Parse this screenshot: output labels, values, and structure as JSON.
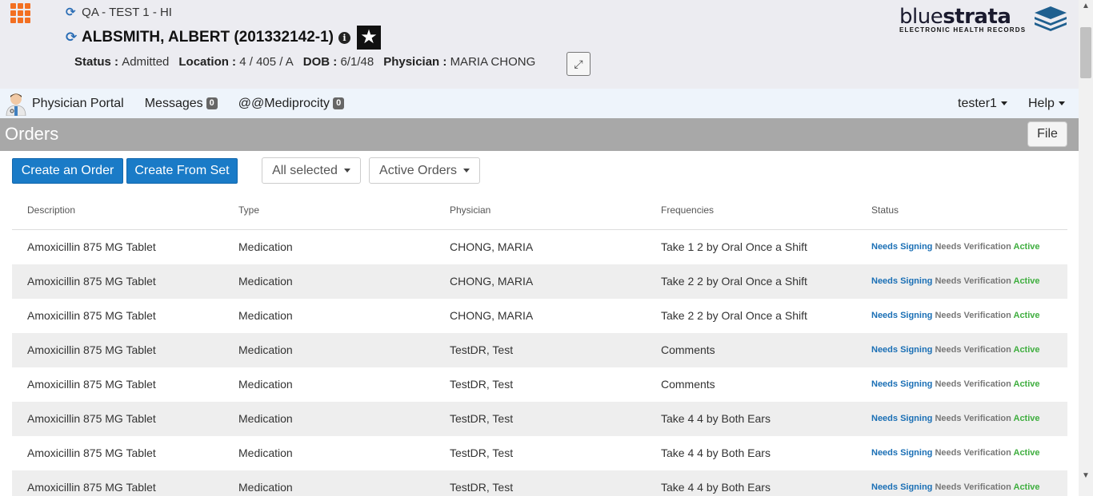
{
  "header": {
    "facility": "QA - TEST 1 - HI",
    "patient_name": "ALBSMITH, ALBERT (201332142-1)",
    "info_glyph": "i",
    "status_label": "Status :",
    "status_value": "Admitted",
    "location_label": "Location :",
    "location_value": "4 / 405 / A",
    "dob_label": "DOB :",
    "dob_value": "6/1/48",
    "physician_label": "Physician :",
    "physician_value": "MARIA CHONG",
    "logo_light": "blue",
    "logo_bold": "strata",
    "logo_tagline": "ELECTRONIC HEALTH RECORDS",
    "accent_color": "#f36f21"
  },
  "nav": {
    "portal": "Physician Portal",
    "messages": "Messages",
    "messages_count": "0",
    "mediprocity": "@@Mediprocity",
    "mediprocity_count": "0",
    "user": "tester1",
    "help": "Help"
  },
  "page": {
    "title": "Orders",
    "file_button": "File"
  },
  "toolbar": {
    "create_order": "Create an Order",
    "create_from_set": "Create From Set",
    "filter_selected": "All selected",
    "filter_status": "Active Orders"
  },
  "table": {
    "columns": [
      "Description",
      "Type",
      "Physician",
      "Frequencies",
      "Status"
    ],
    "status_labels": {
      "sign": "Needs Signing",
      "verify": "Needs Verification",
      "active": "Active"
    },
    "rows": [
      {
        "description": "Amoxicillin 875 MG Tablet",
        "type": "Medication",
        "physician": "CHONG, MARIA",
        "frequency": "Take 1 2 by Oral Once a Shift"
      },
      {
        "description": "Amoxicillin 875 MG Tablet",
        "type": "Medication",
        "physician": "CHONG, MARIA",
        "frequency": "Take 2 2 by Oral Once a Shift"
      },
      {
        "description": "Amoxicillin 875 MG Tablet",
        "type": "Medication",
        "physician": "CHONG, MARIA",
        "frequency": "Take 2 2 by Oral Once a Shift"
      },
      {
        "description": "Amoxicillin 875 MG Tablet",
        "type": "Medication",
        "physician": "TestDR, Test",
        "frequency": "Comments"
      },
      {
        "description": "Amoxicillin 875 MG Tablet",
        "type": "Medication",
        "physician": "TestDR, Test",
        "frequency": "Comments"
      },
      {
        "description": "Amoxicillin 875 MG Tablet",
        "type": "Medication",
        "physician": "TestDR, Test",
        "frequency": "Take 4 4 by Both Ears"
      },
      {
        "description": "Amoxicillin 875 MG Tablet",
        "type": "Medication",
        "physician": "TestDR, Test",
        "frequency": "Take 4 4 by Both Ears"
      },
      {
        "description": "Amoxicillin 875 MG Tablet",
        "type": "Medication",
        "physician": "TestDR, Test",
        "frequency": "Take 4 4 by Both Ears"
      }
    ]
  }
}
